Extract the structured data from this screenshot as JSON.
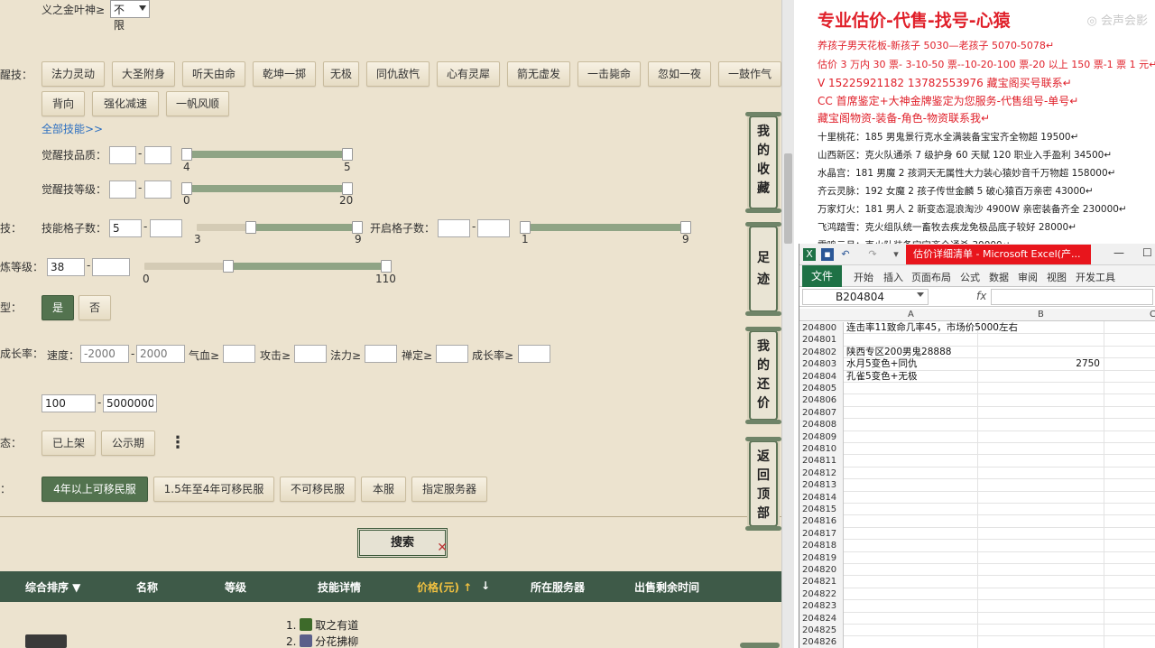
{
  "filters": {
    "gold_leaf_label": "义之金叶神≥",
    "gold_leaf_select": "不限",
    "awaken_label": "醒技：",
    "awaken_skills_row1": [
      "法力灵动",
      "大圣附身",
      "听天由命",
      "乾坤一掷",
      "无极",
      "同仇敌忾",
      "心有灵犀",
      "箭无虚发",
      "一击毙命",
      "忽如一夜",
      "一鼓作气"
    ],
    "awaken_skills_row2": [
      "背向",
      "强化减速",
      "一帆风顺"
    ],
    "all_skills_link": "全部技能>>",
    "quality_label": "觉醒技品质：",
    "quality_min_tick": "4",
    "quality_max_tick": "5",
    "level_label": "觉醒技等级：",
    "level_min_tick": "0",
    "level_max_tick": "20",
    "slots_prefix": "技：",
    "skill_slots_label": "技能格子数：",
    "skill_slots_min": "5",
    "skill_slots_min_tick": "3",
    "skill_slots_max_tick": "9",
    "open_slots_label": "开启格子数：",
    "open_slots_min_tick": "1",
    "open_slots_max_tick": "9",
    "refine_label": "炼等级：",
    "refine_min": "38",
    "refine_min_tick": "0",
    "refine_max_tick": "110",
    "type_label": "型：",
    "yes": "是",
    "no": "否",
    "growth_label": "成长率：",
    "speed_label": "速度：",
    "speed_min_ph": "-2000",
    "speed_max_ph": "2000",
    "hp_label": "气血≥",
    "atk_label": "攻击≥",
    "mag_label": "法力≥",
    "zen_label": "禅定≥",
    "growth2_label": "成长率≥",
    "price_min": "100",
    "price_max": "5000000",
    "status_label": "态：",
    "status_listed": "已上架",
    "status_public": "公示期",
    "more_icon": "⋮",
    "server_label": "：",
    "server_opts": [
      "4年以上可移民服",
      "1.5年至4年可移民服",
      "不可移民服",
      "本服",
      "指定服务器"
    ],
    "search": "搜索",
    "dash": "-"
  },
  "side_nav": [
    "我的收藏",
    "足迹",
    "我的还价",
    "返回顶部"
  ],
  "table_head": {
    "sort": "综合排序 ▼",
    "name": "名称",
    "level": "等级",
    "skills": "技能详情",
    "price": "价格(元) ↑",
    "price_down": "↓",
    "server": "所在服务器",
    "time": "出售剩余时间"
  },
  "result_skills": [
    "1. ",
    "取之有道",
    "2. ",
    "分花拂柳"
  ],
  "doc": {
    "title": "专业估价-代售-找号-心猿",
    "watermark": "◎ 会声会影",
    "lines_red": [
      "养孩子男天花板-新孩子 5030—老孩子 5070-5078↵",
      "估价 3 万内 30 票- 3-10-50 票--10-20-100 票-20 以上 150 票-1 票 1 元↵",
      "V 15225921182       13782553976     藏宝阁买号联系↵",
      "CC 首席鉴定+大神金牌鉴定为您服务-代售组号-单号↵",
      "藏宝阁物资-装备-角色-物资联系我↵"
    ],
    "lines_black": [
      "十里桃花：185 男鬼景行克水全满装备宝宝齐全物超 19500↵",
      "山西新区：克火队通杀 7 级护身 60 天赋 120 职业入手盈利 34500↵",
      "水晶宫：181 男魔 2 孩洞天无属性大力装心猿妙音千万物超 158000↵",
      "齐云灵脉：192 女魔 2 孩子传世金麟 5 破心猿百万亲密 43000↵",
      "万家灯火：181 男人 2 新变态混浪淘沙 4900W 亲密装备齐全 230000↵",
      "飞鸿踏雪：克火组队统一畜牧去疾龙免极品底子较好 28000↵",
      "雷鸣云月：克火队装备宝宝齐全通杀 30000↵"
    ]
  },
  "excel": {
    "title": "估价详细清单 - Microsoft Excel(产...",
    "win_min": "—",
    "win_max": "☐",
    "tabs": [
      "文件",
      "开始",
      "插入",
      "页面布局",
      "公式",
      "数据",
      "审阅",
      "视图",
      "开发工具"
    ],
    "name_box": "B204804",
    "fx": "fx",
    "col_a": "A",
    "col_b": "B",
    "col_c": "C",
    "rows": [
      {
        "n": "204800",
        "a": "连击率11致命几率45，市场价5000左右",
        "b": ""
      },
      {
        "n": "204801",
        "a": "",
        "b": ""
      },
      {
        "n": "204802",
        "a": "陕西专区200男鬼28888",
        "b": ""
      },
      {
        "n": "204803",
        "a": "水月5变色+同仇",
        "b": "2750"
      },
      {
        "n": "204804",
        "a": "孔雀5变色+无极",
        "b": ""
      },
      {
        "n": "204805",
        "a": "",
        "b": ""
      },
      {
        "n": "204806",
        "a": "",
        "b": ""
      },
      {
        "n": "204807",
        "a": "",
        "b": ""
      },
      {
        "n": "204808",
        "a": "",
        "b": ""
      },
      {
        "n": "204809",
        "a": "",
        "b": ""
      },
      {
        "n": "204810",
        "a": "",
        "b": ""
      },
      {
        "n": "204811",
        "a": "",
        "b": ""
      },
      {
        "n": "204812",
        "a": "",
        "b": ""
      },
      {
        "n": "204813",
        "a": "",
        "b": ""
      },
      {
        "n": "204814",
        "a": "",
        "b": ""
      },
      {
        "n": "204815",
        "a": "",
        "b": ""
      },
      {
        "n": "204816",
        "a": "",
        "b": ""
      },
      {
        "n": "204817",
        "a": "",
        "b": ""
      },
      {
        "n": "204818",
        "a": "",
        "b": ""
      },
      {
        "n": "204819",
        "a": "",
        "b": ""
      },
      {
        "n": "204820",
        "a": "",
        "b": ""
      },
      {
        "n": "204821",
        "a": "",
        "b": ""
      },
      {
        "n": "204822",
        "a": "",
        "b": ""
      },
      {
        "n": "204823",
        "a": "",
        "b": ""
      },
      {
        "n": "204824",
        "a": "",
        "b": ""
      },
      {
        "n": "204825",
        "a": "",
        "b": ""
      },
      {
        "n": "204826",
        "a": "",
        "b": ""
      }
    ]
  },
  "colors": {
    "accent_green": "#53734f",
    "header_green": "#3e5a48",
    "page_bg": "#ece3cf",
    "doc_red": "#e0202a",
    "excel_green": "#1e7145"
  }
}
